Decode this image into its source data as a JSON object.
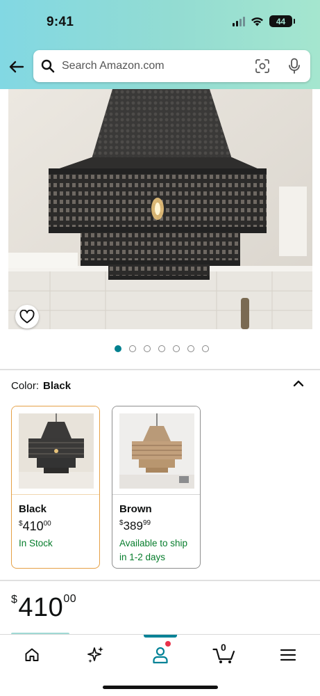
{
  "status_bar": {
    "time": "9:41",
    "battery": "44"
  },
  "search": {
    "placeholder": "Search Amazon.com"
  },
  "icons": {
    "back": "arrow-left-icon",
    "search": "search-icon",
    "camera": "camera-scan-icon",
    "mic": "microphone-icon",
    "favorite": "heart-icon",
    "collapse": "chevron-up-icon"
  },
  "gallery": {
    "image_count": 7,
    "active_index": 0
  },
  "color_selector": {
    "label": "Color:",
    "selected": "Black",
    "options": [
      {
        "name": "Black",
        "currency": "$",
        "whole": "410",
        "cents": "00",
        "availability": "In Stock",
        "selected": true
      },
      {
        "name": "Brown",
        "currency": "$",
        "whole": "389",
        "cents": "99",
        "availability": "Available to ship in 1-2 days",
        "selected": false
      }
    ]
  },
  "price": {
    "currency": "$",
    "whole": "410",
    "cents": "00"
  },
  "bottom_nav": {
    "items": [
      "home-icon",
      "rufus-sparkle-icon",
      "account-icon",
      "cart-icon",
      "menu-icon"
    ],
    "cart_count": "0",
    "active": "account-icon"
  },
  "colors": {
    "header_gradient_start": "#82d8e3",
    "header_gradient_end": "#a5e6cf",
    "accent_teal": "#008296",
    "in_stock_green": "#067d2c",
    "selected_border": "#e5a045",
    "notification": "#e8324a"
  }
}
